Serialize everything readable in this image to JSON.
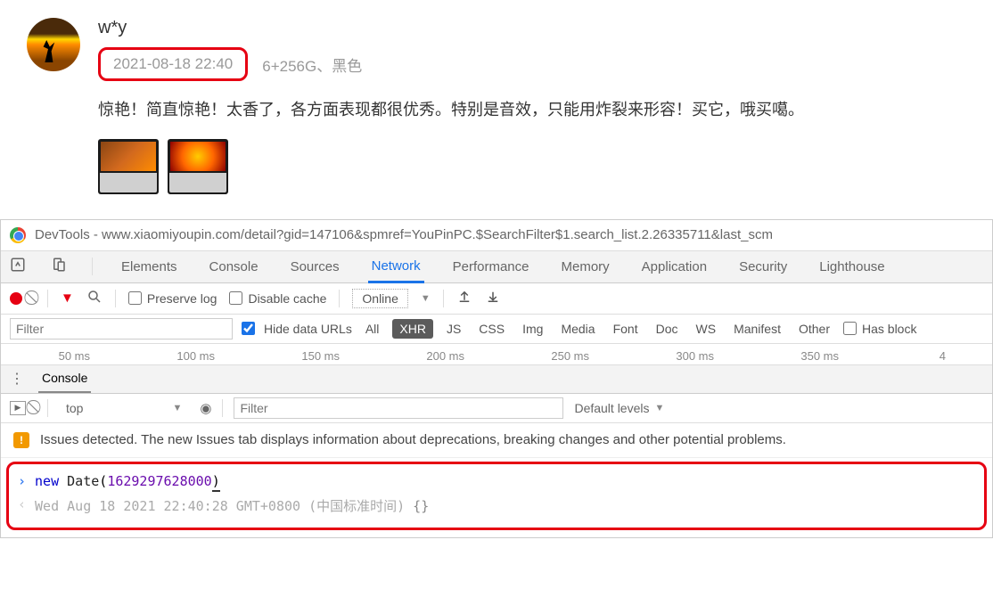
{
  "review": {
    "username": "w*y",
    "timestamp": "2021-08-18 22:40",
    "spec": "6+256G、黑色",
    "text": "惊艳！简直惊艳！太香了，各方面表现都很优秀。特别是音效，只能用炸裂来形容！买它，哦买噶。"
  },
  "devtools": {
    "title": "DevTools - www.xiaomiyoupin.com/detail?gid=147106&spmref=YouPinPC.$SearchFilter$1.search_list.2.26335711&last_scm",
    "tabs": {
      "elements": "Elements",
      "console": "Console",
      "sources": "Sources",
      "network": "Network",
      "performance": "Performance",
      "memory": "Memory",
      "application": "Application",
      "security": "Security",
      "lighthouse": "Lighthouse"
    },
    "toolbar": {
      "preserve_log": "Preserve log",
      "disable_cache": "Disable cache",
      "online": "Online"
    },
    "filter": {
      "placeholder": "Filter",
      "hide_data_urls": "Hide data URLs",
      "all": "All",
      "xhr": "XHR",
      "js": "JS",
      "css": "CSS",
      "img": "Img",
      "media": "Media",
      "font": "Font",
      "doc": "Doc",
      "ws": "WS",
      "manifest": "Manifest",
      "other": "Other",
      "has_blocked": "Has block"
    },
    "timeline": [
      "50 ms",
      "100 ms",
      "150 ms",
      "200 ms",
      "250 ms",
      "300 ms",
      "350 ms",
      "4"
    ],
    "drawer": {
      "console": "Console"
    },
    "console_toolbar": {
      "context": "top",
      "filter_placeholder": "Filter",
      "levels": "Default levels"
    },
    "issues": "Issues detected. The new Issues tab displays information about deprecations, breaking changes and other potential problems.",
    "console": {
      "input_kw": "new",
      "input_cls": " Date",
      "input_paren_open": "(",
      "input_num": "1629297628000",
      "input_paren_close": ")",
      "result": "Wed Aug 18 2021 22:40:28 GMT+0800 (中国标准时间) ",
      "result_braces": "{}"
    }
  }
}
